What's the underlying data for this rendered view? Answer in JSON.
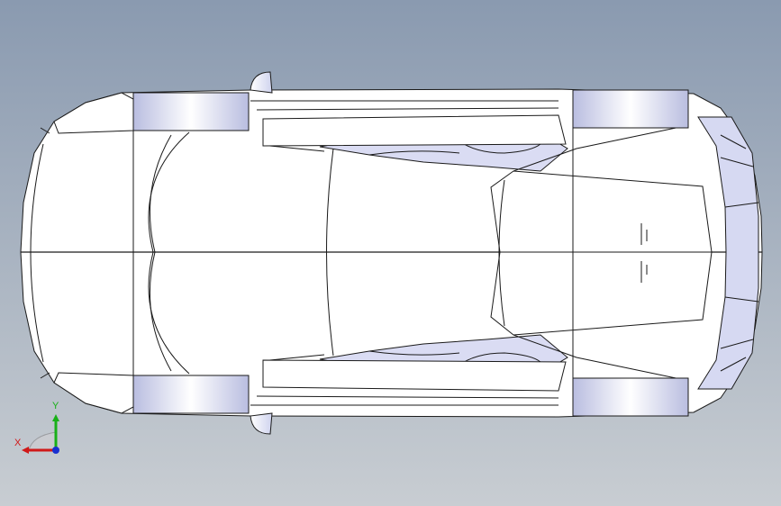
{
  "view": {
    "background_top": "#8a9ab0",
    "background_bottom": "#c8cdd2",
    "model_fill": "#ffffff",
    "shade_fill": "#d8dcf2",
    "wheel_fill": "#e6e8f6",
    "edge_color": "#1a1a1a"
  },
  "triad": {
    "x_label": "X",
    "y_label": "Y",
    "x_color": "#d01818",
    "y_color": "#18b018",
    "z_color": "#1830d0"
  }
}
